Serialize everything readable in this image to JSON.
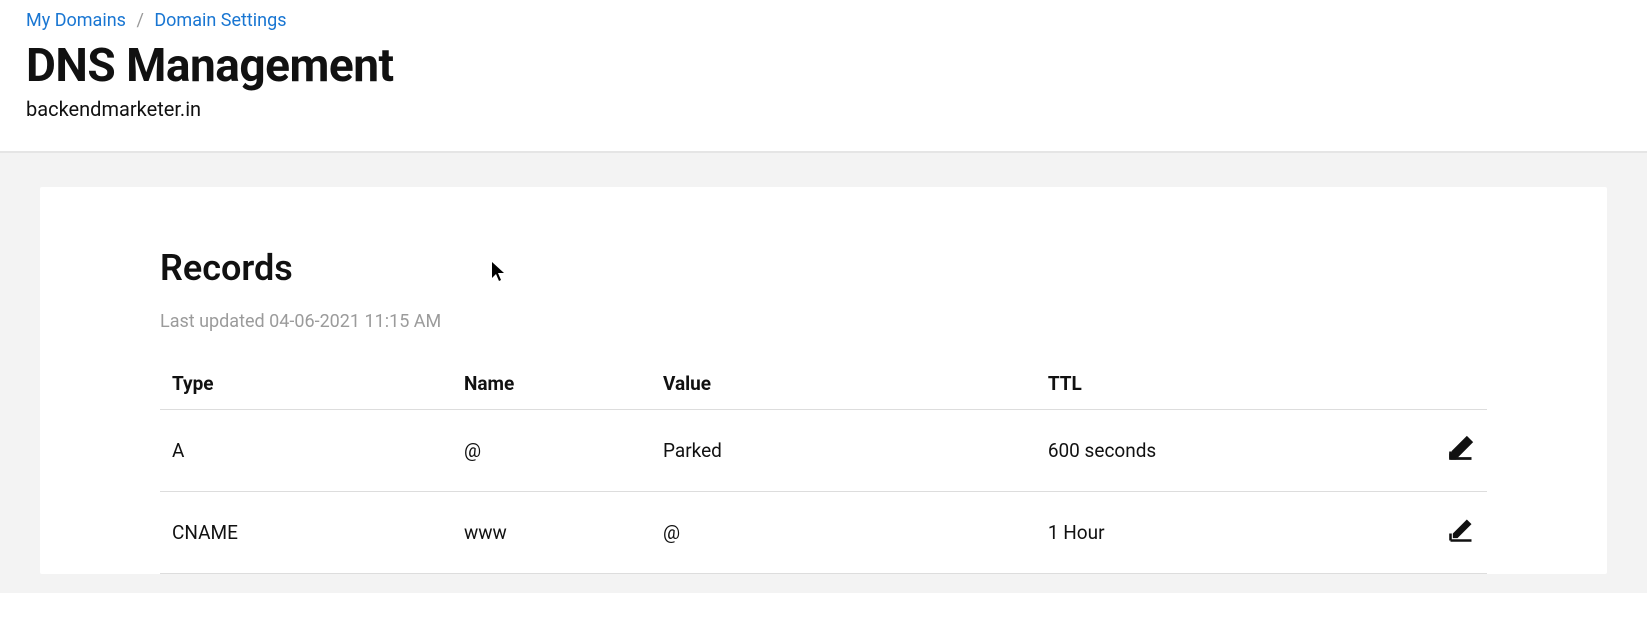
{
  "breadcrumb": {
    "my_domains": "My Domains",
    "domain_settings": "Domain Settings"
  },
  "header": {
    "title": "DNS Management",
    "domain": "backendmarketer.in"
  },
  "records": {
    "section_title": "Records",
    "last_updated": "Last updated 04-06-2021 11:15 AM",
    "columns": {
      "type": "Type",
      "name": "Name",
      "value": "Value",
      "ttl": "TTL"
    },
    "rows": [
      {
        "type": "A",
        "name": "@",
        "value": "Parked",
        "ttl": "600 seconds"
      },
      {
        "type": "CNAME",
        "name": "www",
        "value": "@",
        "ttl": "1 Hour"
      }
    ]
  }
}
